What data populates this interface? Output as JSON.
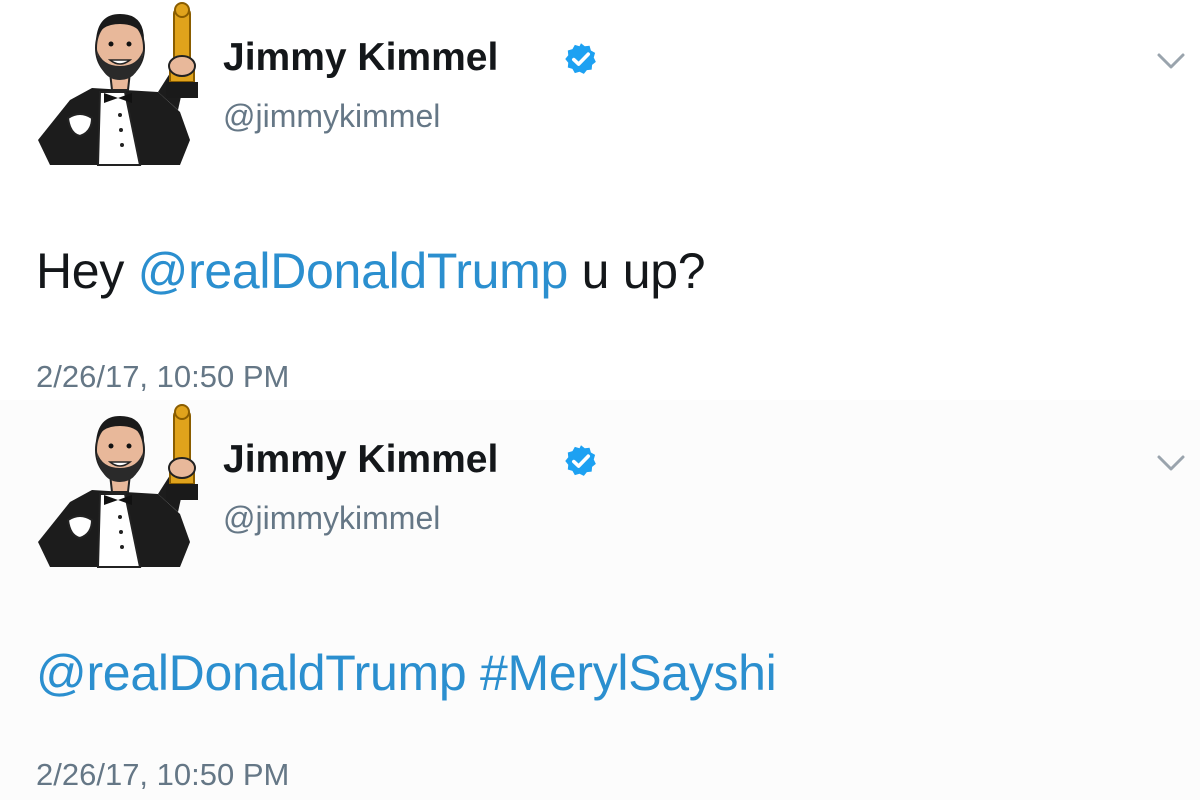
{
  "tweets": [
    {
      "display_name": "Jimmy Kimmel",
      "handle": "@jimmykimmel",
      "verified": true,
      "text_prefix": "Hey ",
      "mention": "@realDonaldTrump",
      "text_suffix": " u up?",
      "hashtag": "",
      "timestamp": "2/26/17, 10:50 PM",
      "avatar_icon": "tuxedo-oscar-cartoon-avatar",
      "menu_icon": "chevron-down-icon"
    },
    {
      "display_name": "Jimmy Kimmel",
      "handle": "@jimmykimmel",
      "verified": true,
      "text_prefix": "",
      "mention": "@realDonaldTrump",
      "text_suffix": " ",
      "hashtag": "#MerylSayshi",
      "timestamp": "2/26/17, 10:50 PM",
      "avatar_icon": "tuxedo-oscar-cartoon-avatar",
      "menu_icon": "chevron-down-icon"
    }
  ],
  "colors": {
    "link": "#2b8fcf",
    "text": "#14171a",
    "secondary": "#657786",
    "verified": "#1da1f2"
  }
}
